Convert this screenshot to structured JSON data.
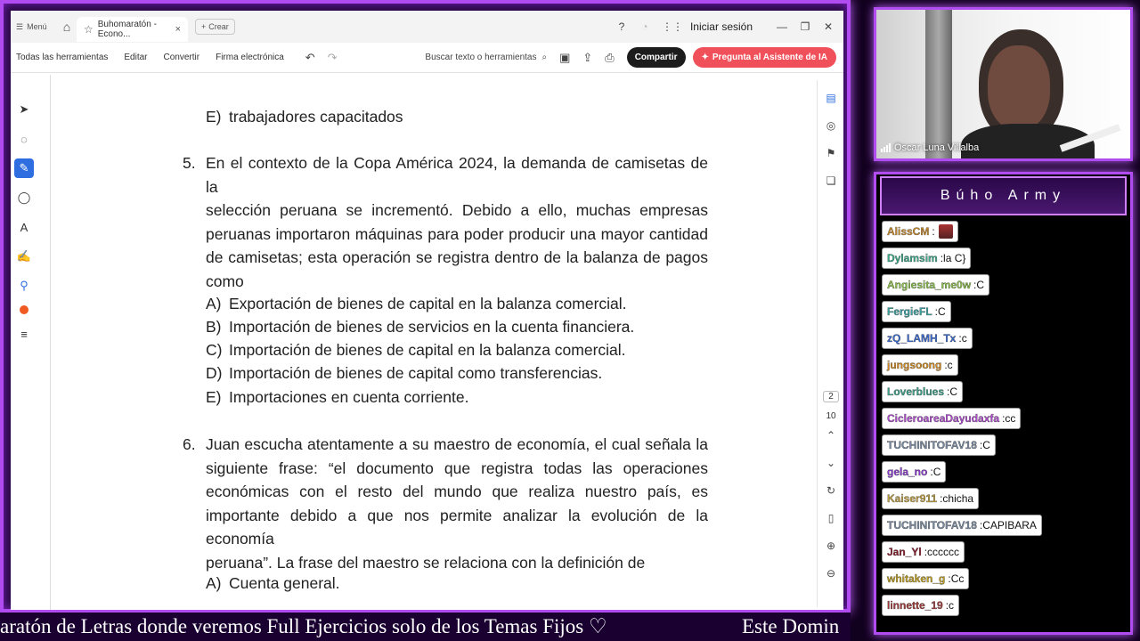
{
  "browser": {
    "menu_label": "Menú",
    "tab_title": "Buhomaratón - Econo...",
    "new_tab_label": "Crear",
    "signin_label": "Iniciar sesión"
  },
  "toolbar": {
    "all_tools": "Todas las herramientas",
    "edit": "Editar",
    "convert": "Convertir",
    "esign": "Firma electrónica",
    "search_label": "Buscar texto o herramientas",
    "share_label": "Compartir",
    "ai_label": "Pregunta al Asistente de IA"
  },
  "document": {
    "prev_option": {
      "letter": "E)",
      "text": "trabajadores capacitados"
    },
    "q5": {
      "number": "5.",
      "lines": [
        "En el contexto de la Copa América 2024, la demanda de camisetas de la",
        "selección peruana se incrementó. Debido a ello, muchas empresas",
        "peruanas importaron máquinas para poder producir una mayor cantidad",
        "de camisetas; esta operación se registra dentro de la balanza de pagos",
        "como"
      ],
      "options": [
        {
          "letter": "A)",
          "text": "Exportación de bienes de capital en la balanza comercial."
        },
        {
          "letter": "B)",
          "text": "Importación de bienes de servicios en la cuenta financiera."
        },
        {
          "letter": "C)",
          "text": "Importación de bienes de capital en la balanza comercial."
        },
        {
          "letter": "D)",
          "text": "Importación de bienes de capital como transferencias."
        },
        {
          "letter": "E)",
          "text": "Importaciones en cuenta corriente."
        }
      ]
    },
    "q6": {
      "number": "6.",
      "lines": [
        "Juan escucha atentamente a su maestro de economía, el cual señala la",
        "siguiente frase: “el documento que registra todas las operaciones",
        "económicas con el resto del mundo que realiza nuestro país, es",
        "importante debido a que nos permite analizar la evolución de la economía",
        "peruana”. La frase del maestro se relaciona con la definición de"
      ],
      "options": [
        {
          "letter": "A)",
          "text": "Cuenta general."
        }
      ]
    }
  },
  "page_nav": {
    "current": "2",
    "total": "10"
  },
  "ticker": {
    "text_a": "aratón de Letras donde veremos Full Ejercicios solo de los Temas Fijos ♡",
    "text_b": "Este Domin"
  },
  "webcam": {
    "name": "Oscar Luna Villalba"
  },
  "chat": {
    "title": "Búho Army",
    "messages": [
      {
        "user": "AlissCM",
        "text": "",
        "color": "#c98a2a",
        "avatar": true
      },
      {
        "user": "Dylamsim",
        "text": "la C}",
        "color": "#3aaa8a"
      },
      {
        "user": "Angiesita_me0w",
        "text": "C",
        "color": "#8ac04a"
      },
      {
        "user": "FergieFL",
        "text": "C",
        "color": "#3aa0a0"
      },
      {
        "user": "zQ_LAMH_Tx",
        "text": "c",
        "color": "#3a6ad0"
      },
      {
        "user": "jungsoong",
        "text": "c",
        "color": "#d08a20"
      },
      {
        "user": "Loverblues",
        "text": "C",
        "color": "#3aa08a"
      },
      {
        "user": "CicleroareaDayudaxfa",
        "text": "cc",
        "color": "#b04ad0"
      },
      {
        "user": "TUCHINITOFAV18",
        "text": "C",
        "color": "#7a8aa0"
      },
      {
        "user": "gela_no",
        "text": "C",
        "color": "#8a3ad0"
      },
      {
        "user": "Kaiser911",
        "text": "chicha",
        "color": "#c0a040"
      },
      {
        "user": "TUCHINITOFAV18",
        "text": "CAPIBARA",
        "color": "#7a8aa0"
      },
      {
        "user": "Jan_Yl",
        "text": "cccccc",
        "color": "#8a1a2a"
      },
      {
        "user": "whitaken_g",
        "text": "Cc",
        "color": "#c0a020"
      },
      {
        "user": "linnette_19",
        "text": "c",
        "color": "#a03a3a"
      }
    ]
  }
}
